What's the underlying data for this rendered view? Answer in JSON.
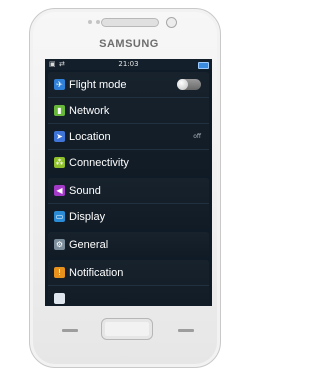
{
  "device": {
    "brand": "SAMSUNG"
  },
  "status_bar": {
    "time": "21:03"
  },
  "settings": {
    "group_connections": [
      {
        "label": "Flight mode",
        "icon": "airplane-icon",
        "color": "#2f80d8",
        "control": "toggle"
      },
      {
        "label": "Network",
        "icon": "network-icon",
        "color": "#67b83a"
      },
      {
        "label": "Location",
        "icon": "location-icon",
        "color": "#3f74d8",
        "value": "off"
      },
      {
        "label": "Connectivity",
        "icon": "connectivity-icon",
        "color": "#8fbf2a"
      }
    ],
    "group_media": [
      {
        "label": "Sound",
        "icon": "speaker-icon",
        "color": "#a33ac8"
      },
      {
        "label": "Display",
        "icon": "display-icon",
        "color": "#2a8bd6"
      }
    ],
    "group_general": [
      {
        "label": "General",
        "icon": "gear-icon",
        "color": "#7c8e9c"
      }
    ],
    "group_notification": [
      {
        "label": "Notification",
        "icon": "notification-icon",
        "color": "#e8911c"
      }
    ]
  }
}
